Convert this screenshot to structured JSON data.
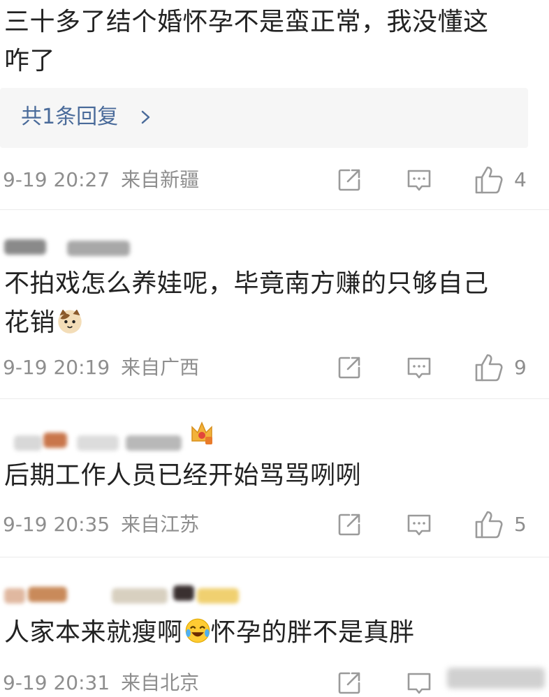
{
  "comments": [
    {
      "text_line1": "三十多了结个婚怀孕不是蛮正常，我没懂这",
      "text_line2": "咋了",
      "reply_label": "共1条回复",
      "time": "9-19 20:27",
      "location": "来自新疆",
      "likes": "4"
    },
    {
      "text_line1": "不拍戏怎么养娃呢，毕竟南方赚的只够自己",
      "text_line2": "花销",
      "time": "9-19 20:19",
      "location": "来自广西",
      "likes": "9"
    },
    {
      "text_line1": "后期工作人员已经开始骂骂咧咧",
      "time": "9-19 20:35",
      "location": "来自江苏",
      "likes": "5"
    },
    {
      "text_part1": "人家本来就瘦啊",
      "text_part2": "怀孕的胖不是真胖",
      "time": "9-19 20:31",
      "location": "来自北京"
    }
  ],
  "icons": {
    "share": "share-icon",
    "comment": "comment-icon",
    "like": "thumbs-up-icon",
    "chevron": "chevron-right-icon",
    "emoji_cat": "cat-emoji-icon",
    "emoji_laugh": "laugh-cry-emoji-icon"
  },
  "colors": {
    "link_blue": "#4a6b9a",
    "meta_gray": "#8e8e8e",
    "divider": "#ebebeb",
    "reply_bg": "#f6f6f6"
  }
}
